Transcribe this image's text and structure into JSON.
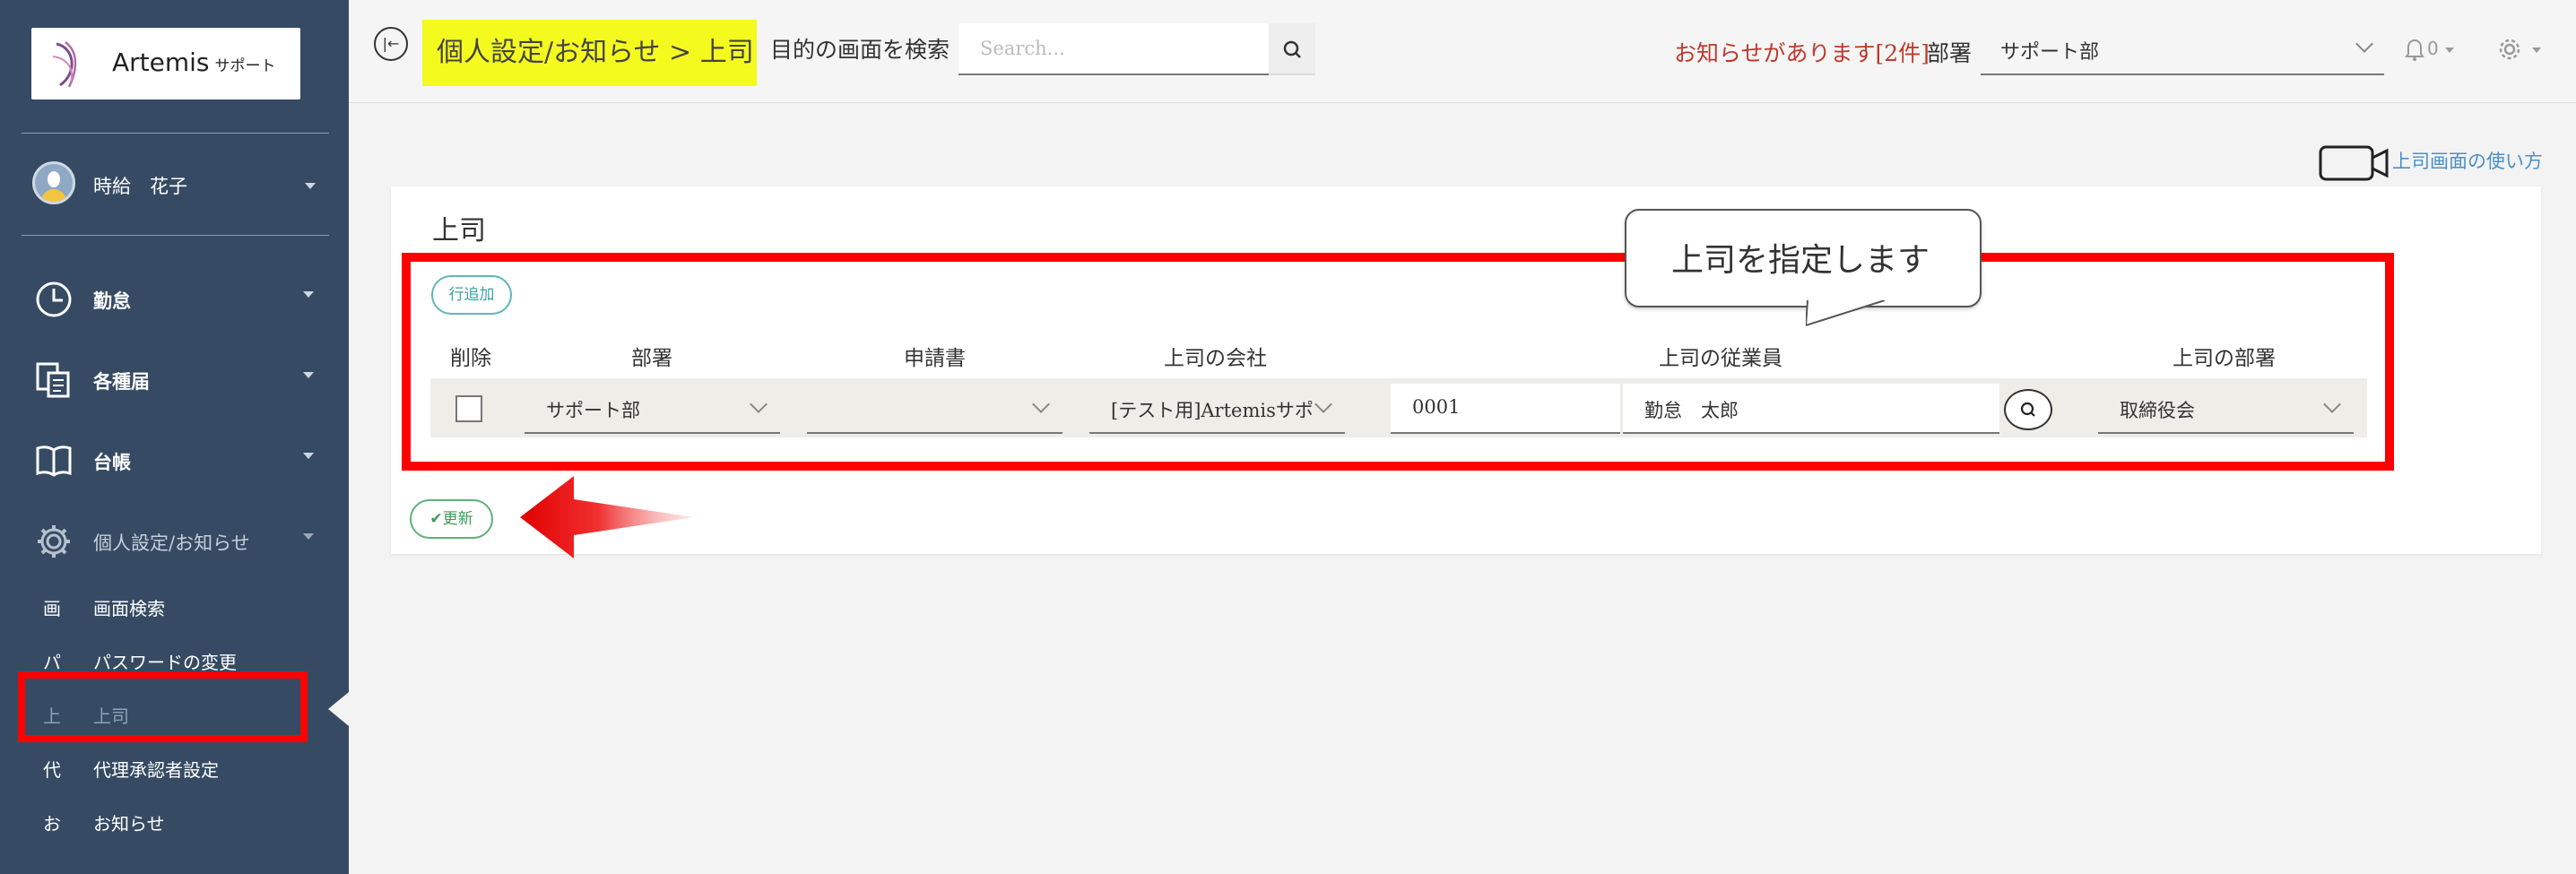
{
  "sidebar": {
    "logo": {
      "name": "Artemis",
      "sub": "サポート"
    },
    "user": {
      "name": "時給　花子"
    },
    "menu": [
      {
        "label": "勤怠",
        "icon": "clock-icon"
      },
      {
        "label": "各種届",
        "icon": "documents-icon"
      },
      {
        "label": "台帳",
        "icon": "book-icon"
      },
      {
        "label": "個人設定/お知らせ",
        "icon": "gear-icon"
      }
    ],
    "submenu": [
      {
        "char": "画",
        "label": "画面検索"
      },
      {
        "char": "パ",
        "label": "パスワードの変更"
      },
      {
        "char": "上",
        "label": "上司"
      },
      {
        "char": "代",
        "label": "代理承認者設定"
      },
      {
        "char": "お",
        "label": "お知らせ"
      }
    ]
  },
  "header": {
    "back_icon": "|←",
    "breadcrumb": "個人設定/お知らせ > 上司",
    "search_label": "目的の画面を検索",
    "search_placeholder": "Search...",
    "notice": "お知らせがあります[2件]",
    "dept_label": "部署",
    "dept_value": "サポート部",
    "bell_count": "0"
  },
  "help_link": "上司画面の使い方",
  "card": {
    "title": "上司",
    "add_row_label": "行追加",
    "columns": [
      "削除",
      "部署",
      "申請書",
      "上司の会社",
      "上司の従業員",
      "上司の部署"
    ],
    "row": {
      "department": "サポート部",
      "form": "",
      "company": "[テスト用]Artemisサポ",
      "employee_code": "0001",
      "employee_name": "勤怠　太郎",
      "boss_department": "取締役会"
    },
    "update_label": "更新"
  },
  "callout": "上司を指定します",
  "colors": {
    "sidebar": "#364b63",
    "highlight": "#f4fa1e",
    "annotation": "#ff0000",
    "notice": "#c0392b"
  }
}
